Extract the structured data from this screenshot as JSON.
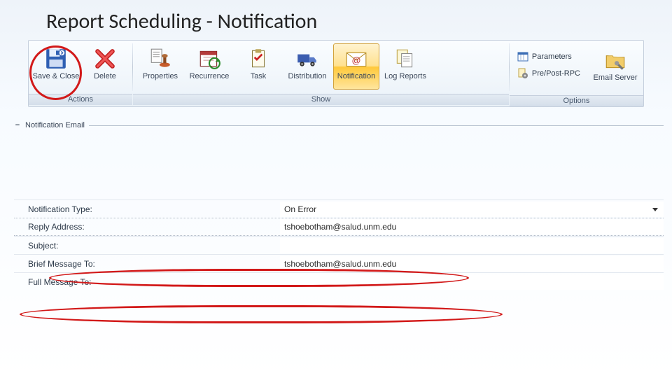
{
  "title": "Report Scheduling - Notification",
  "ribbon": {
    "groups": {
      "actions": {
        "label": "Actions"
      },
      "show": {
        "label": "Show"
      },
      "options": {
        "label": "Options"
      }
    },
    "buttons": {
      "saveClose": "Save & Close",
      "delete": "Delete",
      "properties": "Properties",
      "recurrence": "Recurrence",
      "task": "Task",
      "distribution": "Distribution",
      "notification": "Notification",
      "logReports": "Log Reports",
      "parameters": "Parameters",
      "prePostRpc": "Pre/Post-RPC",
      "emailServer": "Email Server"
    }
  },
  "section": {
    "header": "Notification Email",
    "fields": {
      "notificationType": {
        "label": "Notification Type:",
        "value": "On Error"
      },
      "replyAddress": {
        "label": "Reply Address:",
        "value": "tshoebotham@salud.unm.edu"
      },
      "subject": {
        "label": "Subject:",
        "value": ""
      },
      "briefMessageTo": {
        "label": "Brief Message To:",
        "value": "tshoebotham@salud.unm.edu"
      },
      "fullMessageTo": {
        "label": "Full Message To:",
        "value": ""
      }
    }
  }
}
